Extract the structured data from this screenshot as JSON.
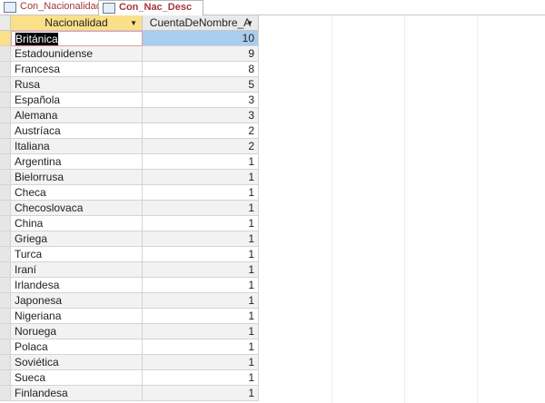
{
  "tabs": [
    {
      "label": "Con_Nacionalidad",
      "active": false
    },
    {
      "label": "Con_Nac_Desc",
      "active": true
    }
  ],
  "columns": [
    "Nacionalidad",
    "CuentaDeNombre_A"
  ],
  "rows": [
    [
      "Británica",
      "10"
    ],
    [
      "Estadounidense",
      "9"
    ],
    [
      "Francesa",
      "8"
    ],
    [
      "Rusa",
      "5"
    ],
    [
      "Española",
      "3"
    ],
    [
      "Alemana",
      "3"
    ],
    [
      "Austríaca",
      "2"
    ],
    [
      "Italiana",
      "2"
    ],
    [
      "Argentina",
      "1"
    ],
    [
      "Bielorrusa",
      "1"
    ],
    [
      "Checa",
      "1"
    ],
    [
      "Checoslovaca",
      "1"
    ],
    [
      "China",
      "1"
    ],
    [
      "Griega",
      "1"
    ],
    [
      "Turca",
      "1"
    ],
    [
      "Iraní",
      "1"
    ],
    [
      "Irlandesa",
      "1"
    ],
    [
      "Japonesa",
      "1"
    ],
    [
      "Nigeriana",
      "1"
    ],
    [
      "Noruega",
      "1"
    ],
    [
      "Polaca",
      "1"
    ],
    [
      "Soviética",
      "1"
    ],
    [
      "Sueca",
      "1"
    ],
    [
      "Finlandesa",
      "1"
    ]
  ]
}
